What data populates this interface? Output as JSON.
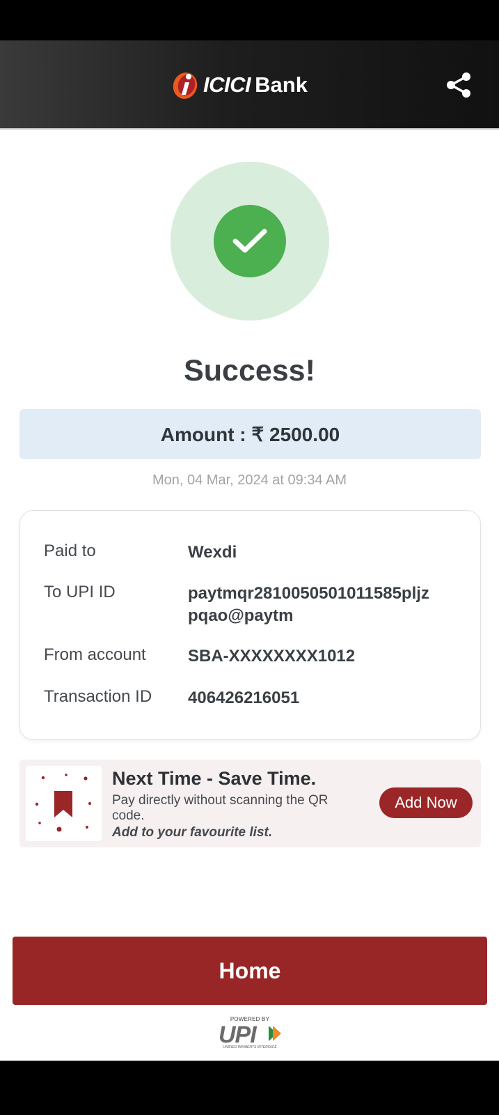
{
  "header": {
    "logo_brand": "ICICI",
    "logo_bank": "Bank",
    "share_icon": "share-icon"
  },
  "status": {
    "title": "Success!",
    "icon": "check-icon",
    "colors": {
      "outer": "#d8eddb",
      "inner": "#4caf50"
    }
  },
  "amount": {
    "text": "Amount : ₹ 2500.00"
  },
  "datetime": "Mon, 04 Mar, 2024 at 09:34 AM",
  "details": [
    {
      "label": "Paid to",
      "value": "Wexdi"
    },
    {
      "label": "To UPI ID",
      "value": "paytmqr2810050501011585pljzpqao@paytm"
    },
    {
      "label": "From account",
      "value": "SBA-XXXXXXXX1012"
    },
    {
      "label": "Transaction ID",
      "value": "406426216051"
    }
  ],
  "promo": {
    "icon": "bookmark-icon",
    "title": "Next Time - Save Time.",
    "description": "Pay directly without scanning the QR code.",
    "cta": "Add to your favourite list.",
    "button": "Add Now"
  },
  "home_button": "Home",
  "footer": {
    "powered_by": "POWERED BY",
    "upi": "UPI",
    "upi_full": "UNIFIED PAYMENTS INTERFACE"
  },
  "colors": {
    "brand_red": "#982627",
    "amount_bg": "#e1ecf6"
  }
}
